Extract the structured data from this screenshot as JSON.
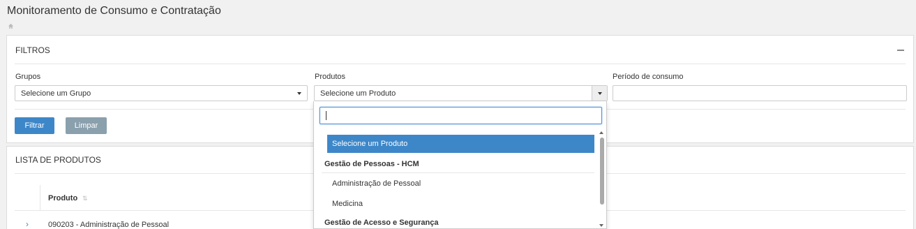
{
  "page": {
    "title": "Monitoramento de Consumo e Contratação"
  },
  "filtros": {
    "heading": "FILTROS",
    "grupos_label": "Grupos",
    "grupos_value": "Selecione um Grupo",
    "produtos_label": "Produtos",
    "produtos_value": "Selecione um Produto",
    "periodo_label": "Período de consumo",
    "periodo_value": "",
    "filtrar_label": "Filtrar",
    "limpar_label": "Limpar"
  },
  "lista": {
    "heading": "LISTA DE PRODUTOS",
    "column_produto": "Produto",
    "rows": [
      {
        "produto": "090203 - Administração de Pessoal"
      }
    ]
  },
  "dropdown": {
    "search_value": "",
    "selected_option": "Selecione um Produto",
    "groups": [
      {
        "label": "Gestão de Pessoas - HCM",
        "options": [
          "Administração de Pessoal",
          "Medicina"
        ]
      },
      {
        "label": "Gestão de Acesso e Segurança",
        "options": []
      }
    ]
  },
  "colors": {
    "primary": "#3d87c9",
    "secondary": "#8aa0ad",
    "background": "#f1f1f1"
  },
  "icons": {
    "home": "home-icon",
    "collapse": "minus-icon",
    "sort": "sort-icon",
    "expand": "chevron-right-icon"
  }
}
